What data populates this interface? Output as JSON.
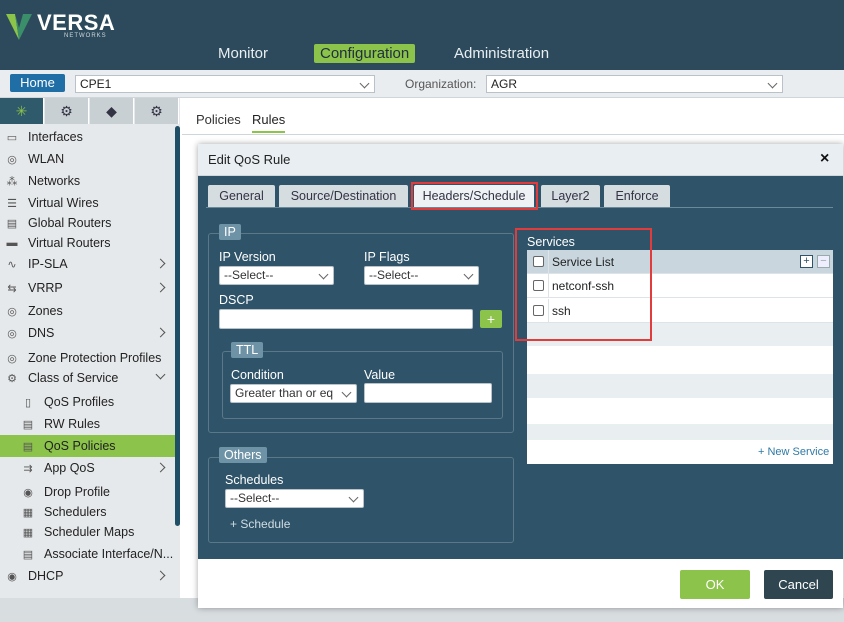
{
  "brand": {
    "name": "VERSA",
    "sub": "NETWORKS"
  },
  "nav": {
    "monitor": "Monitor",
    "configuration": "Configuration",
    "administration": "Administration"
  },
  "toolbar": {
    "home": "Home",
    "appliance": "CPE1",
    "org_label": "Organization:",
    "org_value": "AGR"
  },
  "sidebar": {
    "items": [
      {
        "label": "Interfaces",
        "icon": "interfaces-icon"
      },
      {
        "label": "WLAN",
        "icon": "wifi-icon"
      },
      {
        "label": "Networks",
        "icon": "network-icon"
      },
      {
        "label": "Virtual Wires",
        "icon": "wire-icon"
      },
      {
        "label": "Global Routers",
        "icon": "router-icon"
      },
      {
        "label": "Virtual Routers",
        "icon": "router-icon"
      },
      {
        "label": "IP-SLA",
        "icon": "sla-icon"
      },
      {
        "label": "VRRP",
        "icon": "vrrp-icon"
      },
      {
        "label": "Zones",
        "icon": "zone-icon"
      },
      {
        "label": "DNS",
        "icon": "dns-icon"
      },
      {
        "label": "Zone Protection Profiles",
        "icon": "shield-icon"
      },
      {
        "label": "Class of Service",
        "icon": "cos-icon"
      },
      {
        "label": "QoS Profiles",
        "icon": "profile-icon"
      },
      {
        "label": "RW Rules",
        "icon": "rules-icon"
      },
      {
        "label": "QoS Policies",
        "icon": "policy-icon"
      },
      {
        "label": "App QoS",
        "icon": "app-icon"
      },
      {
        "label": "Drop Profile",
        "icon": "drop-icon"
      },
      {
        "label": "Schedulers",
        "icon": "scheduler-icon"
      },
      {
        "label": "Scheduler Maps",
        "icon": "map-icon"
      },
      {
        "label": "Associate Interface/N...",
        "icon": "associate-icon"
      },
      {
        "label": "DHCP",
        "icon": "dhcp-icon"
      }
    ]
  },
  "page_tabs": {
    "policies": "Policies",
    "rules": "Rules"
  },
  "modal": {
    "title": "Edit QoS Rule",
    "close": "×",
    "tabs": [
      "General",
      "Source/Destination",
      "Headers/Schedule",
      "Layer2",
      "Enforce"
    ],
    "active_tab": "Headers/Schedule",
    "ip": {
      "legend": "IP",
      "version_label": "IP Version",
      "version_value": "--Select--",
      "flags_label": "IP Flags",
      "flags_value": "--Select--",
      "dscp_label": "DSCP",
      "dscp_value": "",
      "dscp_add": "+",
      "ttl": {
        "legend": "TTL",
        "condition_label": "Condition",
        "condition_value": "Greater than or eq",
        "value_label": "Value",
        "value_value": ""
      }
    },
    "others": {
      "legend": "Others",
      "schedules_label": "Schedules",
      "schedules_value": "--Select--",
      "add_schedule": "+ Schedule"
    },
    "services": {
      "label": "Services",
      "header": "Service List",
      "add": "+",
      "remove": "−",
      "rows": [
        "netconf-ssh",
        "ssh"
      ],
      "new_service": "+ New Service"
    },
    "ok": "OK",
    "cancel": "Cancel"
  },
  "colors": {
    "accent": "#8cc34a",
    "panel": "#2f5368",
    "topbar": "#2c4a5c",
    "highlight": "#e23b3b"
  }
}
